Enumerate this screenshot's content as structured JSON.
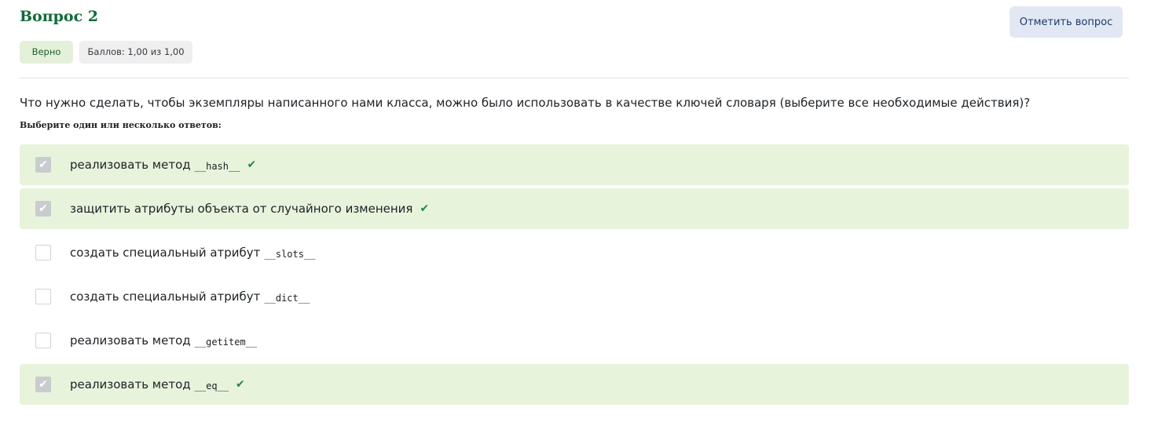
{
  "question": {
    "title": "Вопрос 2",
    "flag_button_label": "Отметить вопрос",
    "status_badge": "Верно",
    "grade_badge": "Баллов: 1,00 из 1,00",
    "text": "Что нужно сделать, чтобы экземпляры написанного нами класса, можно было использовать в качестве ключей словаря (выберите все необходимые действия)?",
    "prompt": "Выберите один или несколько ответов:"
  },
  "answers": [
    {
      "text": "реализовать метод",
      "code": "__hash__",
      "checked": true,
      "correct": true
    },
    {
      "text": "защитить атрибуты объекта от случайного изменения",
      "code": "",
      "checked": true,
      "correct": true
    },
    {
      "text": "создать специальный атрибут",
      "code": "__slots__",
      "checked": false,
      "correct": false
    },
    {
      "text": "создать специальный атрибут",
      "code": "__dict__",
      "checked": false,
      "correct": false
    },
    {
      "text": "реализовать метод",
      "code": "__getitem__",
      "checked": false,
      "correct": false
    },
    {
      "text": "реализовать метод",
      "code": "__eq__",
      "checked": true,
      "correct": true
    }
  ],
  "icons": {
    "checkbox_checked": "checkbox-checked-icon",
    "correct_mark": "check-icon"
  },
  "colors": {
    "title": "#0f6b3a",
    "correct_background": "#e8f3dc",
    "correct_mark": "#1f8a3c",
    "flag_button_background": "#e2e8f3"
  }
}
